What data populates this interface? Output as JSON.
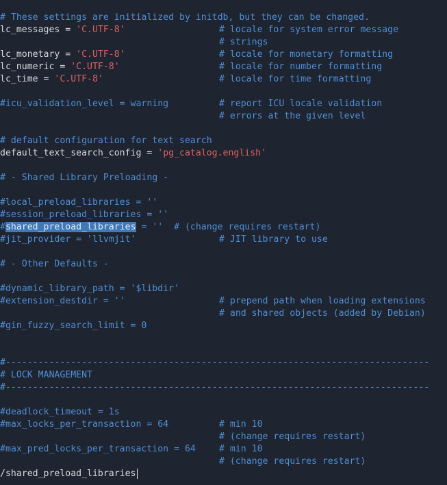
{
  "lines": {
    "l01": {
      "text": "# These settings are initialized by initdb, but they can be changed."
    },
    "l02": {
      "key": "lc_messages = ",
      "val": "'C.UTF-8'",
      "comment": "# locale for system error message"
    },
    "l03": {
      "comment": "# strings"
    },
    "l04": {
      "key": "lc_monetary = ",
      "val": "'C.UTF-8'",
      "comment": "# locale for monetary formatting"
    },
    "l05": {
      "key": "lc_numeric = ",
      "val": "'C.UTF-8'",
      "comment": "# locale for number formatting"
    },
    "l06": {
      "key": "lc_time = ",
      "val": "'C.UTF-8'",
      "comment": "# locale for time formatting"
    },
    "l07": {
      "text": "#icu_validation_level = warning",
      "comment": "# report ICU locale validation"
    },
    "l08": {
      "comment": "# errors at the given level"
    },
    "l09": {
      "text": "# default configuration for text search"
    },
    "l10": {
      "key": "default_text_search_config = ",
      "val": "'pg_catalog.english'"
    },
    "l11": {
      "text": "# - Shared Library Preloading -"
    },
    "l12": {
      "text": "#local_preload_libraries = ''"
    },
    "l13": {
      "text": "#session_preload_libraries = ''"
    },
    "l14": {
      "hash": "#",
      "match": "shared_preload_libraries",
      "rest": " = ''",
      "comment": "  # (change requires restart)"
    },
    "l15": {
      "text": "#jit_provider = 'llvmjit'",
      "comment": "# JIT library to use"
    },
    "l16": {
      "text": "# - Other Defaults -"
    },
    "l17": {
      "text": "#dynamic_library_path = '$libdir'"
    },
    "l18": {
      "text": "#extension_destdir = ''",
      "comment": "# prepend path when loading extensions"
    },
    "l19": {
      "comment": "# and shared objects (added by Debian)"
    },
    "l20": {
      "text": "#gin_fuzzy_search_limit = 0"
    },
    "l21": {
      "text": "#------------------------------------------------------------------------------"
    },
    "l22": {
      "text": "# LOCK MANAGEMENT"
    },
    "l23": {
      "text": "#------------------------------------------------------------------------------"
    },
    "l24": {
      "text": "#deadlock_timeout = 1s"
    },
    "l25": {
      "text": "#max_locks_per_transaction = 64",
      "comment": "# min 10"
    },
    "l26": {
      "comment": "# (change requires restart)"
    },
    "l27": {
      "text": "#max_pred_locks_per_transaction = 64",
      "comment": "# min 10"
    },
    "l28": {
      "comment": "# (change requires restart)"
    }
  },
  "search": {
    "prompt": "/shared_preload_libraries"
  },
  "colors": {
    "background": "#1e2430",
    "comment": "#4f8fd6",
    "string": "#e0605f",
    "text": "#d7dbe0",
    "highlight": "#3f79b8"
  }
}
